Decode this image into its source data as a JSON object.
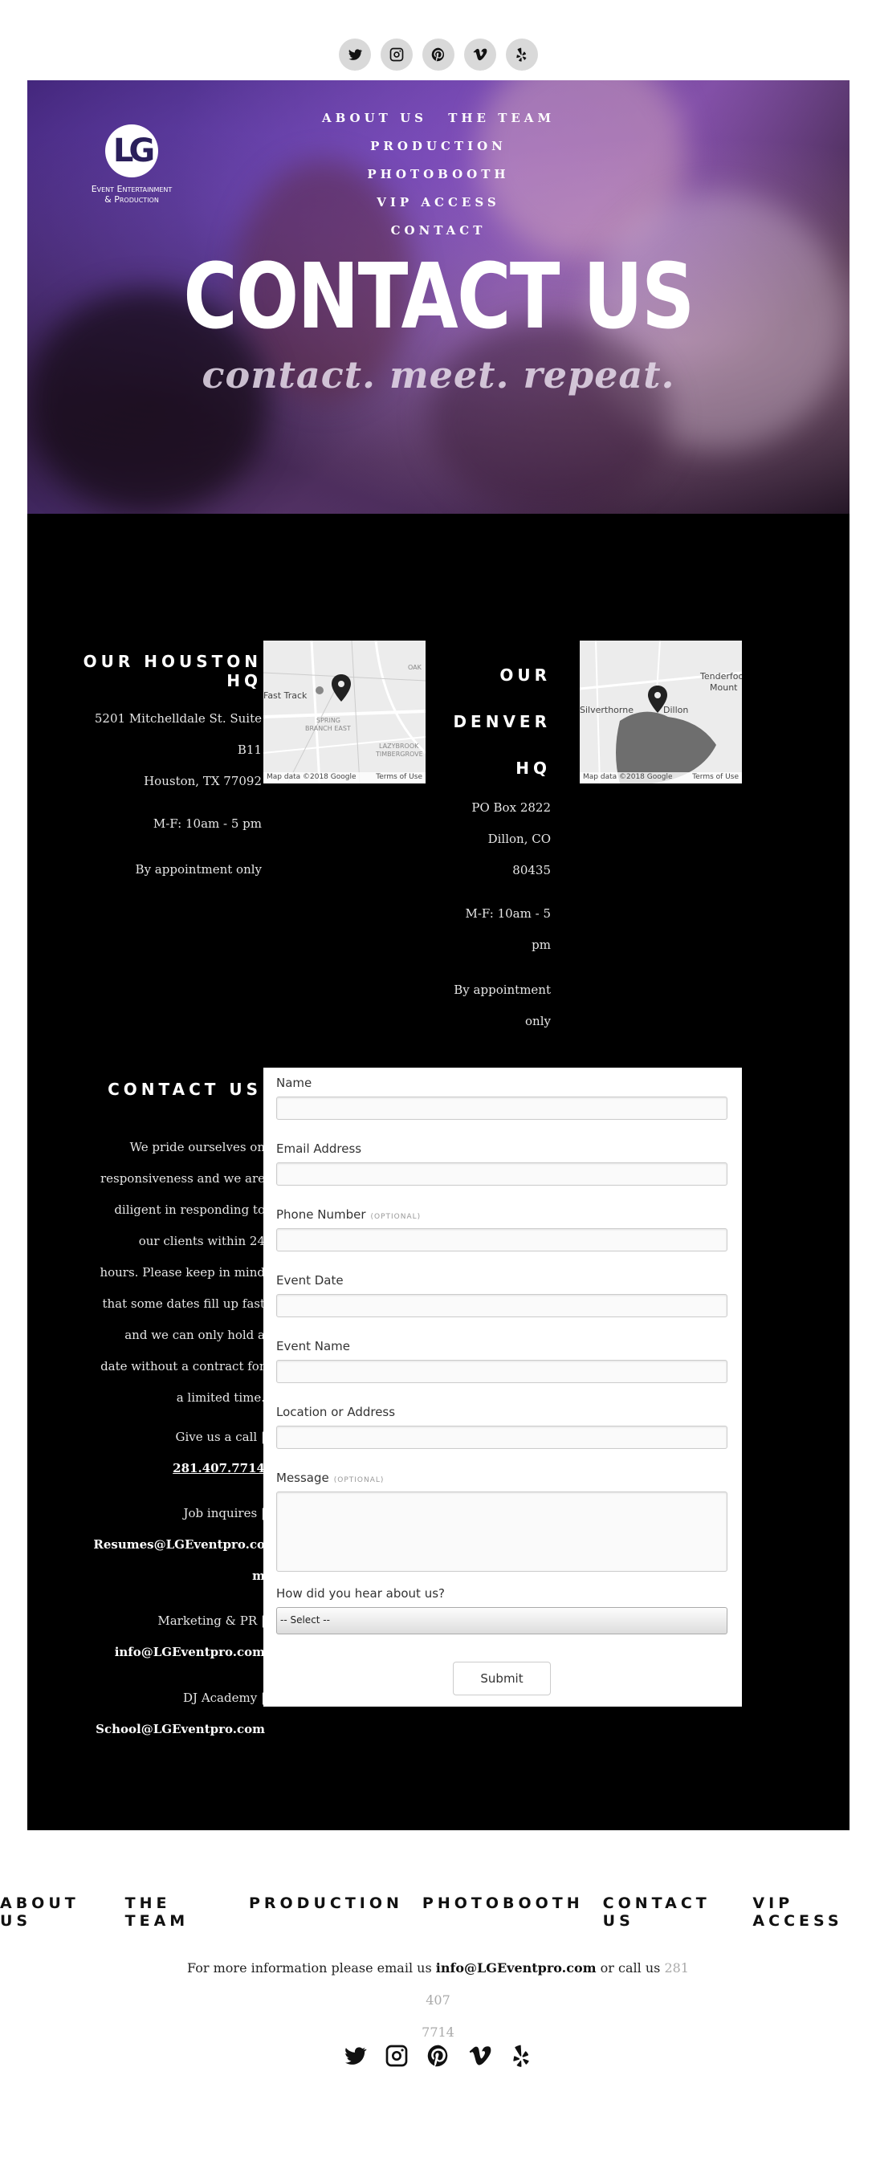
{
  "top_social": [
    "twitter-icon",
    "instagram-icon",
    "pinterest-icon",
    "vimeo-icon",
    "yelp-icon"
  ],
  "logo": {
    "monogram": "LG",
    "line1": "Event Entertainment",
    "line2": "& Production"
  },
  "hero_nav": {
    "about": "ABOUT US",
    "team": "THE TEAM",
    "production": "PRODUCTION",
    "photobooth": "PHOTOBOOTH",
    "vip": "VIP ACCESS",
    "contact": "CONTACT"
  },
  "hero": {
    "title": "CONTACT US",
    "subtitle": "contact. meet. repeat."
  },
  "houston": {
    "heading": "OUR HOUSTON HQ",
    "address1": "5201 Mitchelldale St. Suite",
    "address2": "B11",
    "address3": "Houston, TX 77092",
    "hours": "M-F:   10am  - 5 pm",
    "appointment": "By appointment only",
    "map_labels": [
      "Fast Track",
      "SPRING",
      "BRANCH EAST",
      "LAZYBROOK",
      "TIMBERGROVE",
      "OAK"
    ],
    "map_data": "Map data ©2018 Google",
    "map_terms": "Terms of Use"
  },
  "denver": {
    "heading_1": "OUR",
    "heading_2": "DENVER",
    "heading_3": "HQ",
    "address1": "PO Box 2822",
    "address2": "Dillon, CO",
    "address3": "80435",
    "hours1": "M-F:   10am  - 5",
    "hours2": "pm",
    "appointment1": "By appointment",
    "appointment2": "only",
    "map_labels": [
      "Silverthorne",
      "Dillon",
      "Tenderfoot",
      "Mount"
    ],
    "map_data": "Map data ©2018 Google",
    "map_terms": "Terms of Use"
  },
  "contact": {
    "heading": "CONTACT US",
    "para": [
      "We pride ourselves on",
      "responsiveness and we are",
      "diligent in responding to",
      "our clients within 24",
      "hours. Please keep in mind",
      "that some dates fill up fast",
      "and we can only hold a",
      "date without a contract for",
      "a limited time."
    ],
    "call_label": "Give us a call |",
    "phone": "281.407.7714",
    "job_label": "Job inquires |",
    "job_email_1": "Resumes@LGEventpro.co",
    "job_email_2": "m",
    "marketing_label": "Marketing & PR |",
    "marketing_email": "info@LGEventpro.com",
    "dj_label": "DJ Academy   |",
    "dj_email": "School@LGEventpro.com"
  },
  "form": {
    "name": "Name",
    "email": "Email Address",
    "phone": "Phone Number",
    "optional": "(OPTIONAL)",
    "event_date": "Event Date",
    "event_name": "Event Name",
    "location": "Location or Address",
    "message": "Message",
    "hear": "How did you hear about us?",
    "select_value": "-- Select --",
    "submit": "Submit"
  },
  "footer": {
    "nav": [
      "ABOUT US",
      "THE TEAM",
      "PRODUCTION",
      "PHOTOBOOTH",
      "CONTACT US",
      "VIP ACCESS"
    ],
    "info_prefix": "For more information please email us ",
    "info_email": "info@LGEventpro.com",
    "info_mid": " or call us ",
    "info_phone_1": "281 407",
    "info_phone_2": "7714",
    "social": [
      "twitter-icon",
      "instagram-icon",
      "pinterest-icon",
      "vimeo-icon",
      "yelp-icon"
    ]
  }
}
